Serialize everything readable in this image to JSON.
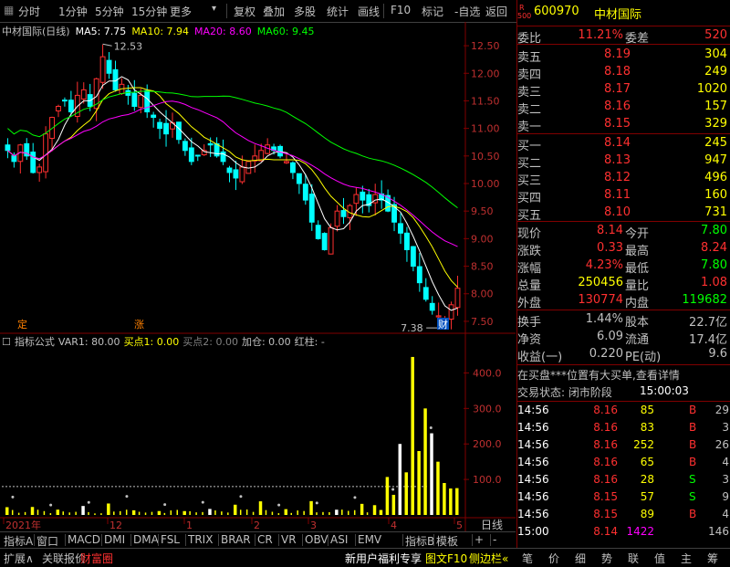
{
  "toolbar": {
    "items": [
      "分时",
      "1分钟",
      "5分钟",
      "15分钟",
      "更多",
      "复权",
      "叠加",
      "多股",
      "统计",
      "画线",
      "F10",
      "标记",
      "-自选",
      "返回"
    ]
  },
  "chart_title": "中材国际(日线)",
  "ma_legend": [
    {
      "label": "MA5: 7.75",
      "color": "#ffffff"
    },
    {
      "label": "MA10: 7.94",
      "color": "#ffff00"
    },
    {
      "label": "MA20: 8.60",
      "color": "#ff00ff"
    },
    {
      "label": "MA60: 9.45",
      "color": "#00ff00"
    }
  ],
  "y_axis_price": [
    "12.50",
    "12.00",
    "11.50",
    "11.00",
    "10.50",
    "10.00",
    "9.50",
    "9.00",
    "8.50",
    "8.00",
    "7.50"
  ],
  "price_labels": {
    "high": "12.53",
    "low": "7.38"
  },
  "markers": {
    "ding": "定",
    "zhang": "涨",
    "cai": "财"
  },
  "indicator_legend": {
    "name": "指标公式",
    "var1": "VAR1: 80.00",
    "buy1": "买点1: 0.00",
    "buy2": "买点2: 0.00",
    "add": "加仓: 0.00",
    "red": "红柱: -"
  },
  "y_axis_ind": [
    "400.0",
    "300.0",
    "200.0",
    "100.0"
  ],
  "x_dates": [
    "2021年",
    "12",
    "1",
    "2",
    "3",
    "4",
    "5"
  ],
  "x_right_label": "日线",
  "tabs": [
    "指标A",
    "窗口",
    "MACD",
    "DMI",
    "DMA",
    "FSL",
    "TRIX",
    "BRAR",
    "CR",
    "VR",
    "OBV",
    "ASI",
    "EMV",
    "指标B",
    "模板",
    "+",
    "-"
  ],
  "bottom": {
    "left": [
      "扩展∧",
      "关联报价",
      "财富圈"
    ],
    "mid": "新用户福利专享",
    "mid2": "图文F10",
    "mid3": "侧边栏«",
    "right": [
      "笔",
      "价",
      "细",
      "势",
      "联",
      "值",
      "主",
      "筹"
    ]
  },
  "quote": {
    "code": "600970",
    "name": "中材国际",
    "badge_r": "R",
    "badge_500": "500",
    "weibi_label": "委比",
    "weibi": "11.21%",
    "weicha_label": "委差",
    "weicha": "520",
    "asks": [
      {
        "label": "卖五",
        "price": "8.19",
        "vol": "304"
      },
      {
        "label": "卖四",
        "price": "8.18",
        "vol": "249"
      },
      {
        "label": "卖三",
        "price": "8.17",
        "vol": "1020"
      },
      {
        "label": "卖二",
        "price": "8.16",
        "vol": "157"
      },
      {
        "label": "卖一",
        "price": "8.15",
        "vol": "329"
      }
    ],
    "bids": [
      {
        "label": "买一",
        "price": "8.14",
        "vol": "245"
      },
      {
        "label": "买二",
        "price": "8.13",
        "vol": "947"
      },
      {
        "label": "买三",
        "price": "8.12",
        "vol": "496"
      },
      {
        "label": "买四",
        "price": "8.11",
        "vol": "160"
      },
      {
        "label": "买五",
        "price": "8.10",
        "vol": "731"
      }
    ],
    "stats": [
      {
        "l1": "现价",
        "v1": "8.14",
        "c1": "#ff3030",
        "l2": "今开",
        "v2": "7.80",
        "c2": "#00ff00"
      },
      {
        "l1": "涨跌",
        "v1": "0.33",
        "c1": "#ff3030",
        "l2": "最高",
        "v2": "8.24",
        "c2": "#ff3030"
      },
      {
        "l1": "涨幅",
        "v1": "4.23%",
        "c1": "#ff3030",
        "l2": "最低",
        "v2": "7.80",
        "c2": "#00ff00"
      },
      {
        "l1": "总量",
        "v1": "250456",
        "c1": "#ffff00",
        "l2": "量比",
        "v2": "1.08",
        "c2": "#ff3030"
      },
      {
        "l1": "外盘",
        "v1": "130774",
        "c1": "#ff3030",
        "l2": "内盘",
        "v2": "119682",
        "c2": "#00ff00"
      }
    ],
    "fin": [
      {
        "l1": "换手",
        "v1": "1.44%",
        "l2": "股本",
        "v2": "22.7亿"
      },
      {
        "l1": "净资",
        "v1": "6.09",
        "l2": "流通",
        "v2": "17.4亿"
      },
      {
        "l1": "收益(一)",
        "v1": "0.220",
        "l2": "PE(动)",
        "v2": "9.6"
      }
    ],
    "notice": "在买盘***位置有大买单,查看详情",
    "status": "交易状态: 闭市阶段",
    "status_time": "15:00:03",
    "ticks": [
      {
        "t": "14:56",
        "p": "8.16",
        "v": "85",
        "s": "B",
        "n": "29"
      },
      {
        "t": "14:56",
        "p": "8.16",
        "v": "83",
        "s": "B",
        "n": "3"
      },
      {
        "t": "14:56",
        "p": "8.16",
        "v": "252",
        "s": "B",
        "n": "26"
      },
      {
        "t": "14:56",
        "p": "8.16",
        "v": "65",
        "s": "B",
        "n": "4"
      },
      {
        "t": "14:56",
        "p": "8.16",
        "v": "28",
        "s": "S",
        "n": "3"
      },
      {
        "t": "14:56",
        "p": "8.15",
        "v": "57",
        "s": "S",
        "n": "9"
      },
      {
        "t": "14:56",
        "p": "8.15",
        "v": "89",
        "s": "B",
        "n": "4"
      },
      {
        "t": "15:00",
        "p": "8.14",
        "v": "1422",
        "s": "",
        "n": "146"
      }
    ]
  },
  "chart_data": {
    "type": "candlestick",
    "title": "中材国际(日线)",
    "ylim": [
      7.3,
      12.7
    ],
    "n": 100,
    "close_path": [
      10.6,
      10.4,
      10.7,
      10.5,
      10.2,
      10.3,
      10.9,
      11.2,
      11.4,
      11.5,
      11.3,
      11.6,
      11.7,
      11.4,
      11.9,
      12.3,
      12.0,
      11.7,
      11.8,
      11.6,
      11.4,
      11.6,
      11.3,
      11.2,
      11.0,
      10.9,
      11.1,
      10.8,
      10.6,
      10.4,
      10.5,
      10.6,
      10.7,
      10.5,
      10.4,
      10.2,
      10.1,
      10.3,
      10.4,
      10.5,
      10.6,
      10.7,
      10.6,
      10.5,
      10.4,
      10.2,
      10.0,
      9.7,
      9.3,
      9.0,
      8.8,
      9.2,
      9.5,
      9.4,
      9.6,
      9.8,
      9.7,
      9.6,
      9.8,
      9.7,
      9.5,
      9.3,
      9.1,
      8.8,
      8.5,
      8.2,
      7.9,
      7.7,
      7.6,
      7.5,
      7.8,
      8.1
    ],
    "indicator_bars_max": 450
  }
}
